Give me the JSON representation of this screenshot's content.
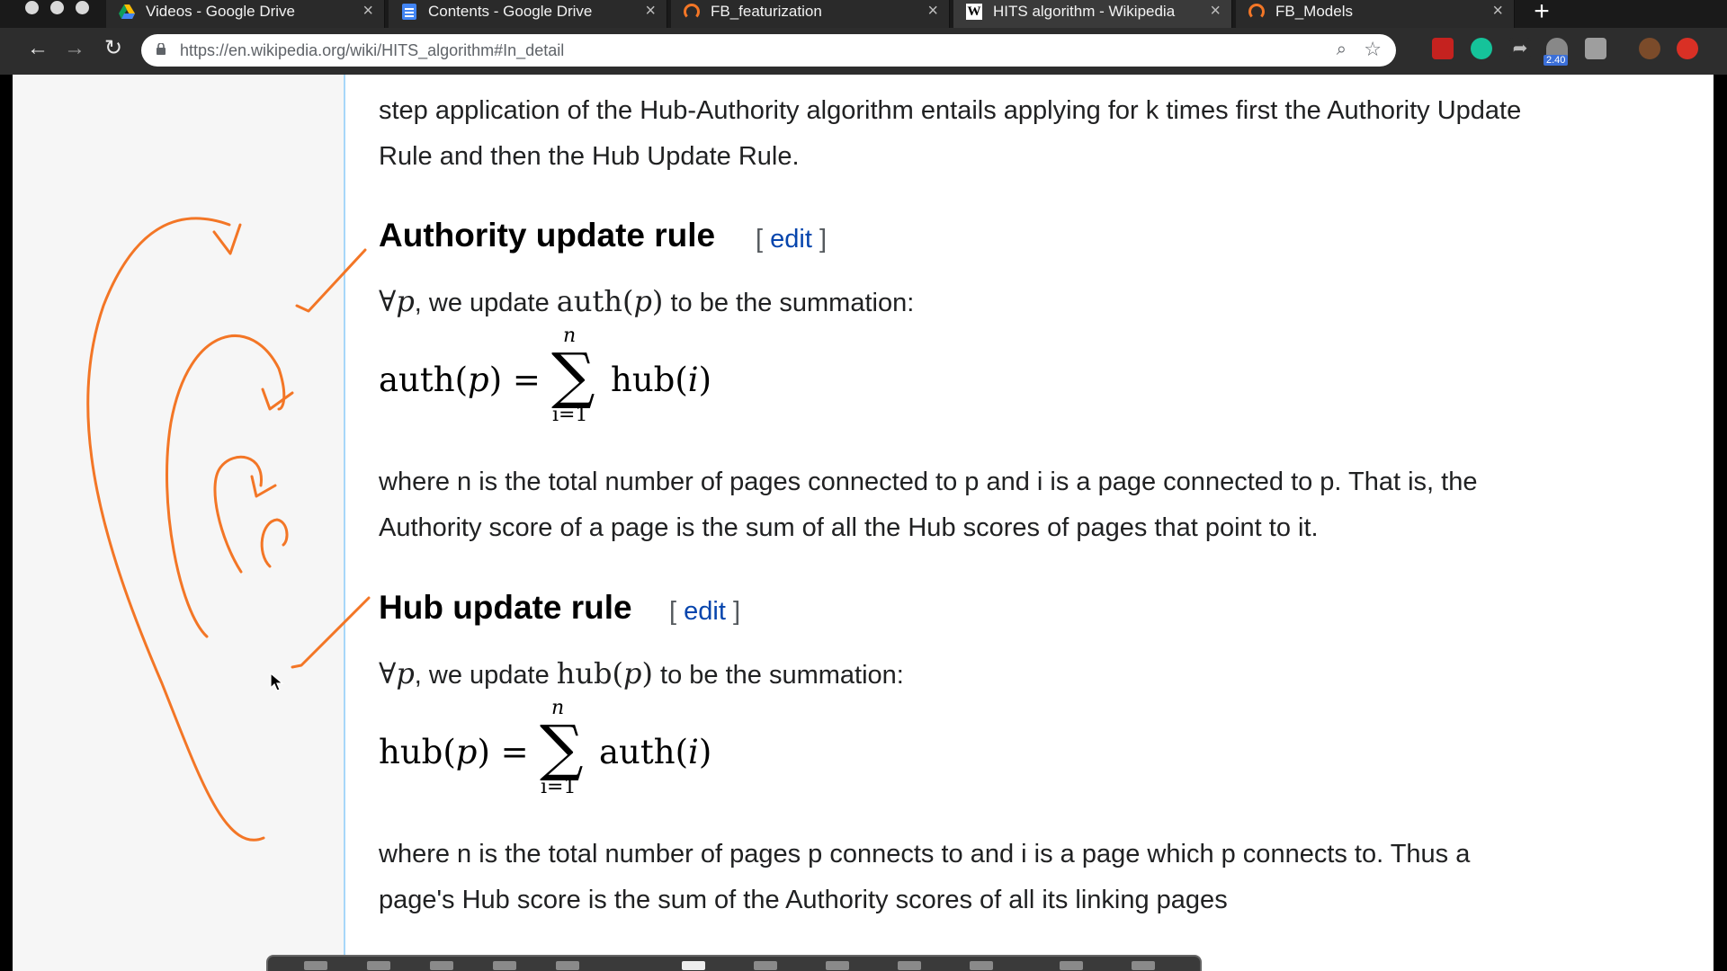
{
  "browser": {
    "tabs": [
      {
        "title": "Videos - Google Drive",
        "icon": "google-drive-icon",
        "active": false
      },
      {
        "title": "Contents - Google Drive",
        "icon": "google-docs-icon",
        "active": false
      },
      {
        "title": "FB_featurization",
        "icon": "jupyter-icon",
        "active": false
      },
      {
        "title": "HITS algorithm - Wikipedia",
        "icon": "wikipedia-icon",
        "active": true
      },
      {
        "title": "FB_Models",
        "icon": "jupyter-icon",
        "active": false
      }
    ],
    "close_glyph": "×",
    "new_tab_glyph": "+",
    "url": "https://en.wikipedia.org/wiki/HITS_algorithm#In_detail",
    "extension_badge": "2.40"
  },
  "article": {
    "intro_line1": "step application of the Hub-Authority algorithm entails applying for k times first the Authority Update",
    "intro_line2": "Rule and then the Hub Update Rule.",
    "sections": [
      {
        "heading": "Authority update rule",
        "edit_open": "[ ",
        "edit_label": "edit",
        "edit_close": " ]",
        "forall_sym": "∀",
        "var_p": "p",
        "text_we_update": ", we update ",
        "math_func": "auth",
        "text_tail": " to be the summation:",
        "formula_lhs_func": "auth",
        "formula_equals": " = ",
        "formula_upper": "n",
        "formula_lower": "i=1",
        "formula_rhs_func": "hub",
        "formula_index": "i",
        "desc_line1": "where n is the total number of pages connected to p and i is a page connected to p. That is, the",
        "desc_line2": "Authority score of a page is the sum of all the Hub scores of pages that point to it."
      },
      {
        "heading": "Hub update rule",
        "edit_open": "[ ",
        "edit_label": "edit",
        "edit_close": " ]",
        "forall_sym": "∀",
        "var_p": "p",
        "text_we_update": ", we update ",
        "math_func": "hub",
        "text_tail": " to be the summation:",
        "formula_lhs_func": "hub",
        "formula_equals": " = ",
        "formula_upper": "n",
        "formula_lower": "i=1",
        "formula_rhs_func": "auth",
        "formula_index": "i",
        "desc_line1": "where n is the total number of pages p connects to and i is a page which p connects to. Thus a",
        "desc_line2": "page's Hub score is the sum of the Authority scores of all its linking pages"
      }
    ]
  },
  "colors": {
    "annotation": "#f37626",
    "link": "#0645ad",
    "sidebar_bg": "#f6f6f6"
  }
}
